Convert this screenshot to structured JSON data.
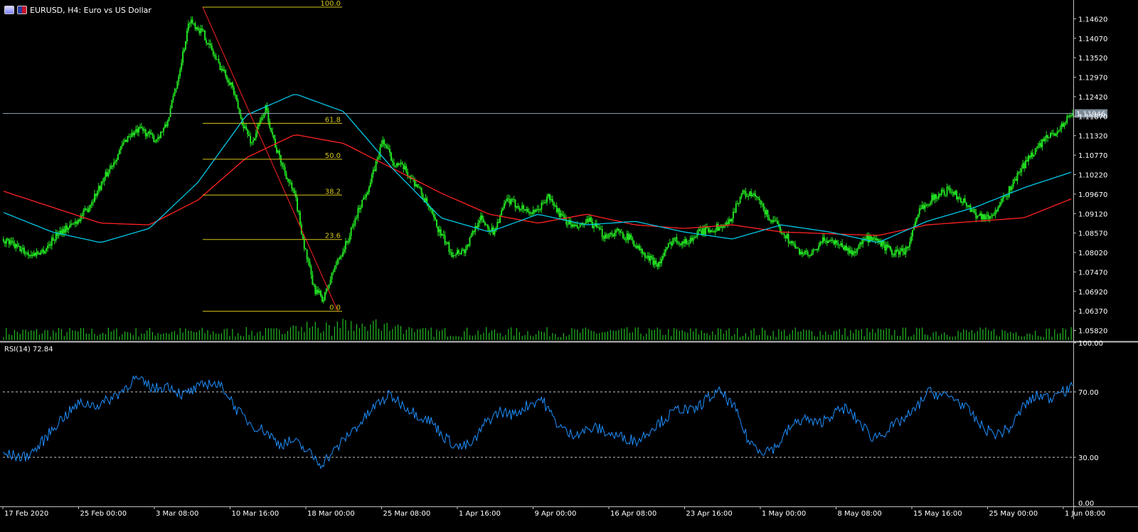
{
  "header": {
    "symbol_line": "EURUSD, H4:  Euro vs US Dollar",
    "icons": [
      "chart-window-icon",
      "currency-flag-icon"
    ]
  },
  "colors": {
    "background": "#000000",
    "candle": "#22e022",
    "volume": "#22bb22",
    "ma_fast": "#00c8e8",
    "ma_slow": "#ff2222",
    "fibo": "#d4c41a",
    "rsi": "#1e90ff",
    "price_line": "#8c9aa8",
    "axis_text": "#ffffff",
    "separator": "#c0c0c0"
  },
  "price_axis": {
    "ticks": [
      "1.14620",
      "1.14070",
      "1.13520",
      "1.12970",
      "1.12420",
      "1.11870",
      "1.11320",
      "1.10770",
      "1.10220",
      "1.09670",
      "1.09120",
      "1.08570",
      "1.08020",
      "1.07470",
      "1.06920",
      "1.06370",
      "1.05820"
    ],
    "current_price": "1.11946"
  },
  "rsi_panel": {
    "label": "RSI(14) 72.84",
    "ticks": [
      "100.00",
      "70.00",
      "30.00",
      "0.00"
    ],
    "levels": [
      70,
      30
    ]
  },
  "time_axis": {
    "labels": [
      "17 Feb 2020",
      "25 Feb 00:00",
      "3 Mar 08:00",
      "10 Mar 16:00",
      "18 Mar 00:00",
      "25 Mar 08:00",
      "1 Apr 16:00",
      "9 Apr 00:00",
      "16 Apr 08:00",
      "23 Apr 16:00",
      "1 May 00:00",
      "8 May 08:00",
      "15 May 16:00",
      "25 May 00:00",
      "1 Jun 08:00"
    ]
  },
  "fibonacci": {
    "high": 1.1495,
    "low": 1.0636,
    "levels": [
      {
        "label": "100.0",
        "ratio": 1.0
      },
      {
        "label": "61.8",
        "ratio": 0.618
      },
      {
        "label": "50.0",
        "ratio": 0.5
      },
      {
        "label": "38.2",
        "ratio": 0.382
      },
      {
        "label": "23.6",
        "ratio": 0.236
      },
      {
        "label": "0.0",
        "ratio": 0.0
      }
    ]
  },
  "chart_data": [
    {
      "type": "candlestick",
      "title": "EURUSD, H4:  Euro vs US Dollar",
      "ylim": [
        1.0555,
        1.1505
      ],
      "x_range": [
        "17 Feb 2020",
        "3 Jun 2020"
      ],
      "close_anchors": [
        [
          0,
          1.084
        ],
        [
          10,
          1.0815
        ],
        [
          20,
          1.0795
        ],
        [
          30,
          1.081
        ],
        [
          40,
          1.086
        ],
        [
          50,
          1.088
        ],
        [
          60,
          1.092
        ],
        [
          70,
          1.099
        ],
        [
          80,
          1.106
        ],
        [
          90,
          1.113
        ],
        [
          100,
          1.115
        ],
        [
          110,
          1.112
        ],
        [
          118,
          1.116
        ],
        [
          125,
          1.127
        ],
        [
          135,
          1.146
        ],
        [
          145,
          1.142
        ],
        [
          155,
          1.134
        ],
        [
          165,
          1.128
        ],
        [
          172,
          1.118
        ],
        [
          180,
          1.111
        ],
        [
          190,
          1.121
        ],
        [
          198,
          1.109
        ],
        [
          205,
          1.102
        ],
        [
          212,
          1.095
        ],
        [
          218,
          1.082
        ],
        [
          225,
          1.07
        ],
        [
          232,
          1.067
        ],
        [
          240,
          1.076
        ],
        [
          250,
          1.084
        ],
        [
          258,
          1.093
        ],
        [
          266,
          1.1
        ],
        [
          275,
          1.112
        ],
        [
          282,
          1.106
        ],
        [
          290,
          1.104
        ],
        [
          300,
          1.099
        ],
        [
          308,
          1.093
        ],
        [
          316,
          1.086
        ],
        [
          325,
          1.08
        ],
        [
          335,
          1.081
        ],
        [
          345,
          1.09
        ],
        [
          355,
          1.086
        ],
        [
          365,
          1.095
        ],
        [
          375,
          1.093
        ],
        [
          385,
          1.091
        ],
        [
          395,
          1.096
        ],
        [
          405,
          1.09
        ],
        [
          415,
          1.087
        ],
        [
          425,
          1.089
        ],
        [
          435,
          1.085
        ],
        [
          445,
          1.086
        ],
        [
          455,
          1.084
        ],
        [
          465,
          1.079
        ],
        [
          475,
          1.077
        ],
        [
          485,
          1.084
        ],
        [
          495,
          1.083
        ],
        [
          505,
          1.086
        ],
        [
          515,
          1.087
        ],
        [
          525,
          1.088
        ],
        [
          535,
          1.097
        ],
        [
          545,
          1.096
        ],
        [
          555,
          1.09
        ],
        [
          565,
          1.086
        ],
        [
          575,
          1.081
        ],
        [
          585,
          1.079
        ],
        [
          595,
          1.084
        ],
        [
          605,
          1.083
        ],
        [
          615,
          1.08
        ],
        [
          625,
          1.084
        ],
        [
          635,
          1.083
        ],
        [
          645,
          1.08
        ],
        [
          655,
          1.081
        ],
        [
          665,
          1.093
        ],
        [
          675,
          1.096
        ],
        [
          685,
          1.098
        ],
        [
          695,
          1.095
        ],
        [
          705,
          1.091
        ],
        [
          715,
          1.09
        ],
        [
          725,
          1.095
        ],
        [
          735,
          1.102
        ],
        [
          745,
          1.108
        ],
        [
          755,
          1.112
        ],
        [
          765,
          1.115
        ],
        [
          775,
          1.1195
        ]
      ],
      "series": [
        {
          "name": "MA fast",
          "values": [
            1.0915,
            1.086,
            1.083,
            1.087,
            1.1,
            1.119,
            1.125,
            1.12,
            1.104,
            1.09,
            1.086,
            1.091,
            1.088,
            1.089,
            1.086,
            1.084,
            1.088,
            1.086,
            1.083,
            1.089,
            1.093,
            1.0985,
            1.103
          ]
        },
        {
          "name": "MA slow",
          "values": [
            1.0975,
            1.093,
            1.0885,
            1.088,
            1.095,
            1.107,
            1.1135,
            1.111,
            1.104,
            1.097,
            1.091,
            1.0885,
            1.091,
            1.088,
            1.087,
            1.088,
            1.086,
            1.0855,
            1.085,
            1.088,
            1.089,
            1.09,
            1.0955
          ]
        }
      ]
    },
    {
      "type": "line",
      "title": "RSI(14) 72.84",
      "ylim": [
        0,
        100
      ],
      "levels": [
        70,
        30
      ],
      "rsi_anchors": [
        [
          0,
          32
        ],
        [
          15,
          30
        ],
        [
          25,
          36
        ],
        [
          40,
          52
        ],
        [
          55,
          63
        ],
        [
          70,
          62
        ],
        [
          85,
          70
        ],
        [
          95,
          78
        ],
        [
          110,
          72
        ],
        [
          120,
          74
        ],
        [
          130,
          68
        ],
        [
          140,
          72
        ],
        [
          150,
          76
        ],
        [
          160,
          72
        ],
        [
          170,
          58
        ],
        [
          180,
          50
        ],
        [
          190,
          46
        ],
        [
          200,
          38
        ],
        [
          210,
          40
        ],
        [
          220,
          34
        ],
        [
          230,
          26
        ],
        [
          240,
          34
        ],
        [
          250,
          44
        ],
        [
          260,
          52
        ],
        [
          270,
          62
        ],
        [
          280,
          68
        ],
        [
          290,
          62
        ],
        [
          300,
          56
        ],
        [
          310,
          52
        ],
        [
          320,
          42
        ],
        [
          330,
          36
        ],
        [
          340,
          38
        ],
        [
          350,
          52
        ],
        [
          360,
          58
        ],
        [
          370,
          56
        ],
        [
          380,
          62
        ],
        [
          390,
          66
        ],
        [
          400,
          52
        ],
        [
          410,
          44
        ],
        [
          420,
          46
        ],
        [
          430,
          48
        ],
        [
          440,
          44
        ],
        [
          450,
          42
        ],
        [
          460,
          40
        ],
        [
          470,
          48
        ],
        [
          480,
          54
        ],
        [
          490,
          60
        ],
        [
          500,
          58
        ],
        [
          510,
          66
        ],
        [
          520,
          70
        ],
        [
          530,
          60
        ],
        [
          540,
          40
        ],
        [
          550,
          34
        ],
        [
          560,
          36
        ],
        [
          570,
          48
        ],
        [
          580,
          54
        ],
        [
          590,
          50
        ],
        [
          600,
          56
        ],
        [
          610,
          60
        ],
        [
          620,
          52
        ],
        [
          630,
          42
        ],
        [
          640,
          46
        ],
        [
          650,
          52
        ],
        [
          660,
          58
        ],
        [
          670,
          70
        ],
        [
          680,
          68
        ],
        [
          690,
          66
        ],
        [
          700,
          58
        ],
        [
          710,
          48
        ],
        [
          720,
          44
        ],
        [
          730,
          48
        ],
        [
          740,
          62
        ],
        [
          750,
          68
        ],
        [
          760,
          66
        ],
        [
          765,
          73
        ],
        [
          770,
          70
        ],
        [
          775,
          72.84
        ]
      ]
    }
  ]
}
